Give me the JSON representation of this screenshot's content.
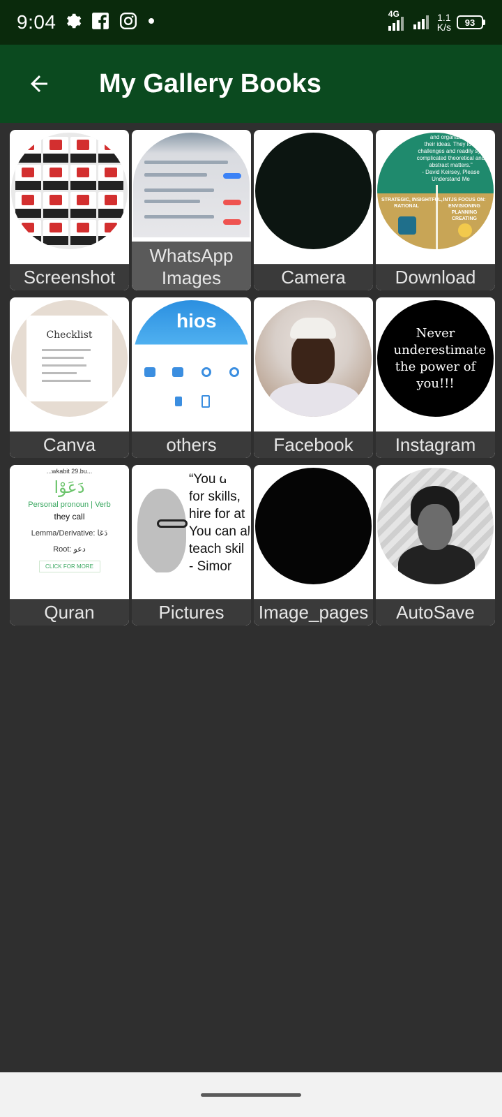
{
  "status_bar": {
    "time": "9:04",
    "network_type": "4G",
    "speed_value": "1.1",
    "speed_unit": "K/s",
    "battery": "93"
  },
  "app_bar": {
    "title": "My Gallery Books"
  },
  "albums": [
    {
      "label": "Screenshot"
    },
    {
      "label_line1": "WhatsApp",
      "label_line2": "Images"
    },
    {
      "label": "Camera"
    },
    {
      "label": "Download"
    },
    {
      "label": "Canva"
    },
    {
      "label": "others"
    },
    {
      "label": "Facebook"
    },
    {
      "label": "Instagram"
    },
    {
      "label": "Quran"
    },
    {
      "label": "Pictures"
    },
    {
      "label": "Image_pages"
    },
    {
      "label": "AutoSave"
    }
  ],
  "thumb_text": {
    "canva_title": "Checklist",
    "instagram_quote": "Never underestimate the power of you!!!",
    "quran_header": "...wkabit 29.bu...",
    "quran_arabic": "دَعَوْا",
    "quran_pos": "Personal pronoun | Verb",
    "quran_meaning": "they call",
    "quran_lemma": "Lemma/Derivative: دَعَا",
    "quran_root": "Root: دعو",
    "quran_button": "CLICK FOR MORE",
    "pictures_quote": "“You d\nfor skills,\nhire for at\nYou can al\nteach skil\n- Simor",
    "others_logo": "hios",
    "download_top": "and organization\ntheir ideas. They love\nchallenges and readily syn\ncomplicated theoretical and\nabstract matters.\"\n- David Keirsey, Please\nUnderstand Me",
    "download_left": "STRATEGIC, INSIGHTFUL,\nRATIONAL",
    "download_right": "INTJS FOCUS ON:\nENVISIONING\nPLANNING\nCREATING"
  },
  "colors": {
    "status_bar": "#0a2a0c",
    "app_bar": "#0b4a1f",
    "background": "#2f2f2f",
    "tile_label": "#3a3a3a"
  }
}
